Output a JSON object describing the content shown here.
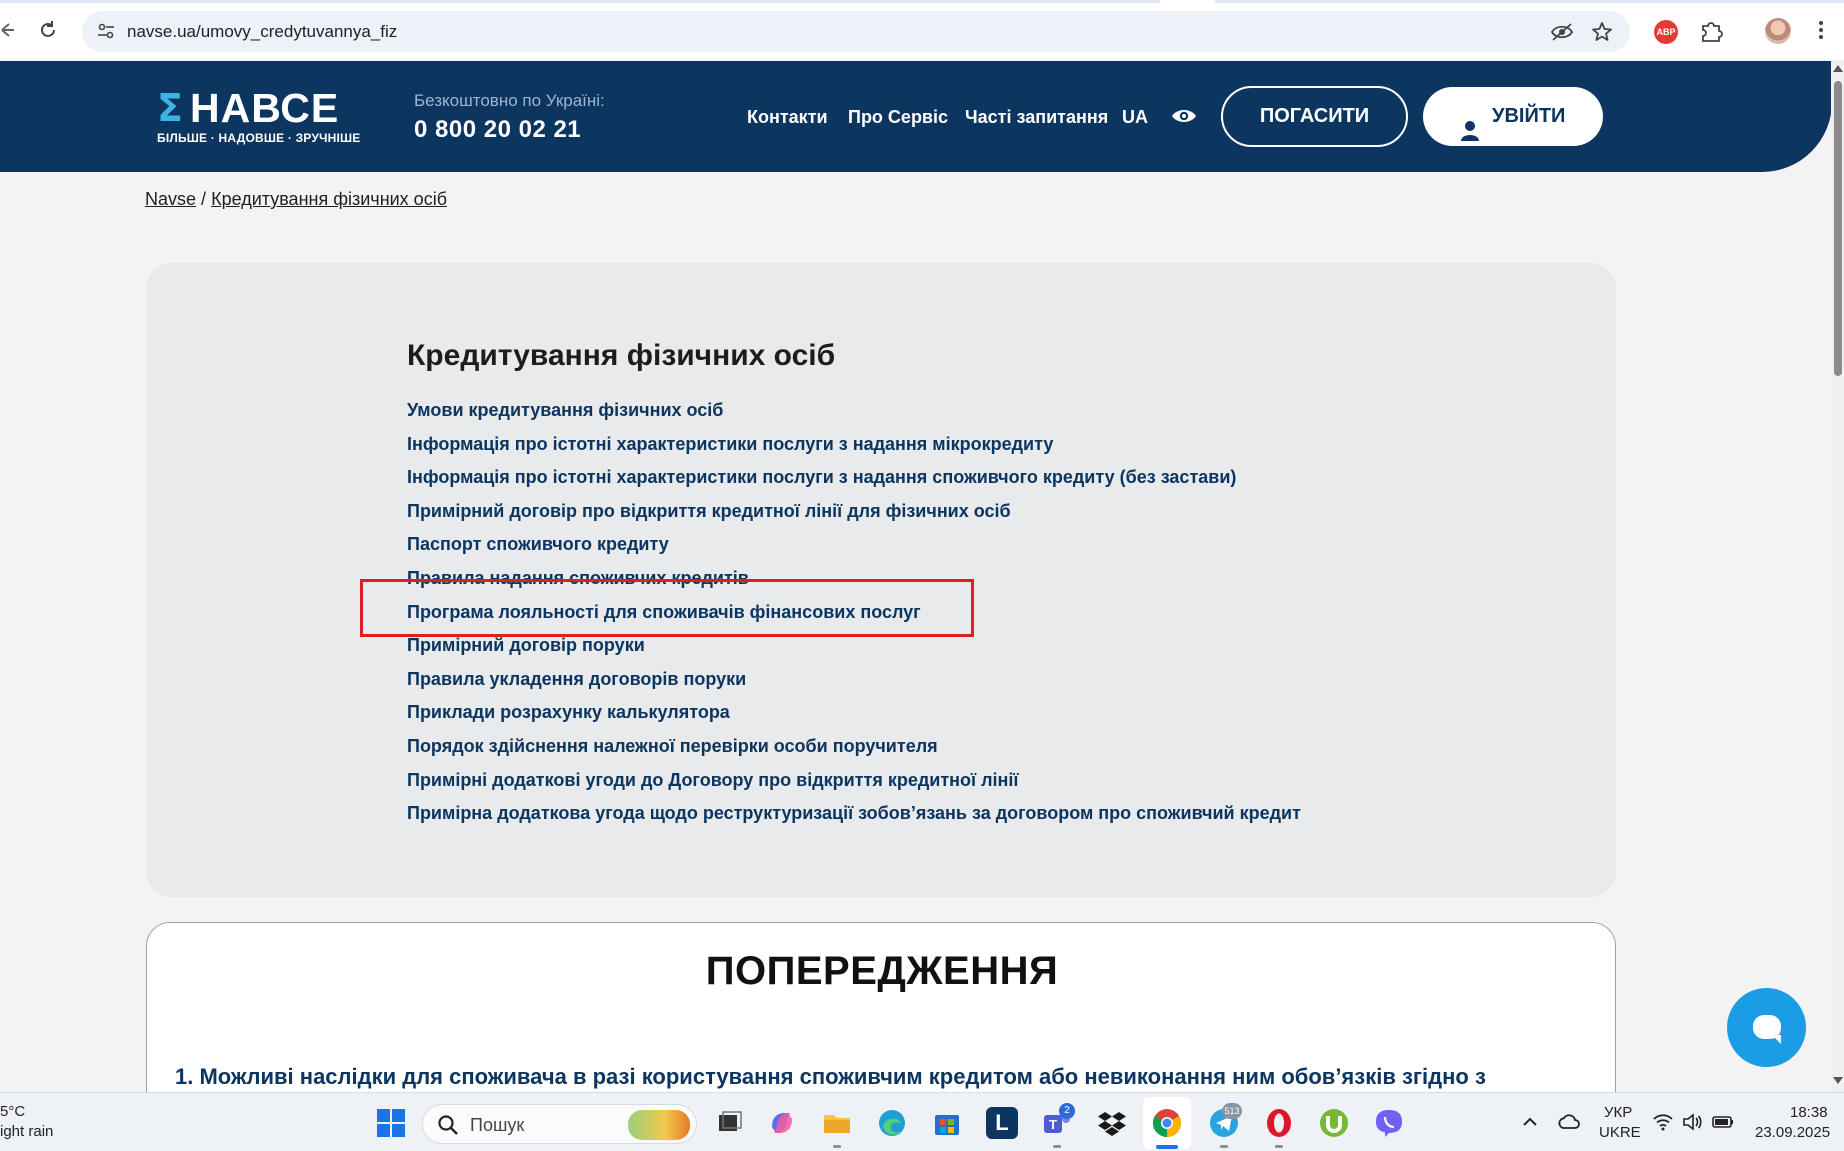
{
  "browser": {
    "url": "navse.ua/umovy_credytuvannya_fiz",
    "extension_abp_label": "ABP"
  },
  "header": {
    "logo_mark": "Σ",
    "logo_word": "НАВСЕ",
    "logo_tagline": "БІЛЬШЕ · НАДОВШЕ · ЗРУЧНІШЕ",
    "hotline_label": "Безкоштовно по Україні:",
    "hotline_number": "0 800 20 02 21",
    "nav": [
      "Контакти",
      "Про Сервіс",
      "Часті запитання",
      "UA"
    ],
    "pay_button": "ПОГАСИТИ",
    "login_button": "УВІЙТИ",
    "brand_color": "#0c3560",
    "accent_color": "#3fb1e5"
  },
  "breadcrumb": {
    "home": "Navse",
    "separator": "/",
    "current": "Кредитування фізичних осіб"
  },
  "section": {
    "title": "Кредитування фізичних осіб",
    "links": [
      "Умови кредитування фізичних осіб",
      "Інформація про істотні характеристики послуги з надання мікрокредиту",
      "Інформація про істотні характеристики послуги з надання споживчого кредиту (без застави)",
      "Примірний договір про відкриття кредитної лінії для фізичних осіб",
      "Паспорт споживчого кредиту",
      "Правила надання споживчих кредитів",
      "Програма лояльності для споживачів фінансових послуг",
      "Примірний договір поруки",
      "Правила укладення договорів поруки",
      "Приклади розрахунку калькулятора",
      "Порядок здійснення належної перевірки особи поручителя",
      "Примірні додаткові угоди до Договору про відкриття кредитної лінії",
      "Примірна додаткова угода щодо реструктуризації зобов’язань за договором про споживчий кредит"
    ],
    "highlighted_link_index": 6,
    "highlight_color": "#e11d1d"
  },
  "warning": {
    "title": "ПОПЕРЕДЖЕННЯ",
    "first_item": "1. Можливі наслідки для споживача в разі користування споживчим кредитом або невиконання ним обов’язків згідно з"
  },
  "taskbar": {
    "weather_temp": "5°C",
    "weather_desc": "ight rain",
    "search_placeholder": "Пошук",
    "teams_badge": "2",
    "telegram_badge": "513",
    "language_top": "УКР",
    "language_bottom": "UKRE",
    "time": "18:38",
    "date": "23.09.2025"
  }
}
